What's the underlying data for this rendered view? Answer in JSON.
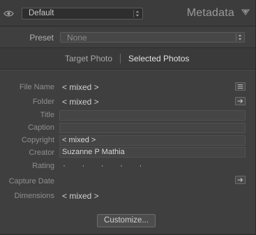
{
  "header": {
    "preset_value": "Default",
    "panel_title": "Metadata"
  },
  "body": {
    "preset_label": "Preset",
    "preset_value": "None",
    "toggle_target": "Target Photo",
    "toggle_selected": "Selected Photos",
    "fields": {
      "file_name": {
        "label": "File Name",
        "value": "< mixed >"
      },
      "folder": {
        "label": "Folder",
        "value": "< mixed >"
      },
      "title": {
        "label": "Title",
        "value": ""
      },
      "caption": {
        "label": "Caption",
        "value": ""
      },
      "copyright": {
        "label": "Copyright",
        "value": "< mixed >"
      },
      "creator": {
        "label": "Creator",
        "value": "Suzanne P Mathia"
      },
      "rating": {
        "label": "Rating",
        "value": "· · · · ·"
      },
      "capture_date": {
        "label": "Capture Date",
        "value": ""
      },
      "dimensions": {
        "label": "Dimensions",
        "value": "< mixed >"
      }
    },
    "customize_label": "Customize..."
  },
  "icons": {
    "visibility": "eye-icon",
    "collapse": "triangle-down-icon",
    "file_list": "list-icon",
    "folder_go": "arrow-right-icon",
    "capture_go": "arrow-right-icon"
  }
}
